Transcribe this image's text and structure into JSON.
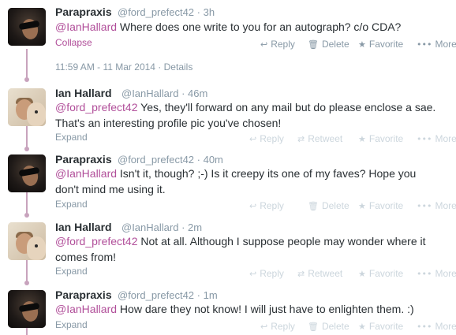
{
  "tweets": [
    {
      "name": "Parapraxis",
      "handle": "@ford_prefect42",
      "time": "3h",
      "mention": "@IanHallard",
      "text": " Where does one write to you for an autograph? c/o CDA?",
      "text2": "",
      "toggle": "Collapse"
    },
    {
      "name": "Ian Hallard",
      "handle": "@IanHallard",
      "time": "46m",
      "mention": "@ford_prefect42",
      "text": " Yes, they'll forward on any mail but do please enclose a sae.",
      "text2": "That's an interesting profile pic you've chosen!",
      "toggle": "Expand"
    },
    {
      "name": "Parapraxis",
      "handle": "@ford_prefect42",
      "time": "40m",
      "mention": "@IanHallard",
      "text": " Isn't it, though? ;-)  Is it creepy its one of my faves? Hope you",
      "text2": "don't mind me using it.",
      "toggle": "Expand"
    },
    {
      "name": "Ian Hallard",
      "handle": "@IanHallard",
      "time": "2m",
      "mention": "@ford_prefect42",
      "text": " Not at all. Although I suppose people may wonder where it",
      "text2": "comes from!",
      "toggle": "Expand"
    },
    {
      "name": "Parapraxis",
      "handle": "@ford_prefect42",
      "time": "1m",
      "mention": "@IanHallard",
      "text": " How dare they not know! I will just have to enlighten them. :)",
      "text2": "",
      "toggle": "Expand"
    }
  ],
  "details": {
    "timestamp": "11:59 AM - 11 Mar 2014",
    "separator": " · ",
    "link": "Details"
  },
  "actions": {
    "reply": "Reply",
    "retweet": "Retweet",
    "delete": "Delete",
    "favorite": "Favorite",
    "more": "More"
  },
  "icons": {
    "reply": "reply-icon",
    "retweet": "retweet-icon",
    "delete": "trash-icon",
    "favorite": "star-icon",
    "more": "more-dots-icon"
  },
  "colors": {
    "accent": "#b14f9a",
    "muted": "#8899a6",
    "faded": "#ccd6dd",
    "thread": "#c8a3bd"
  }
}
